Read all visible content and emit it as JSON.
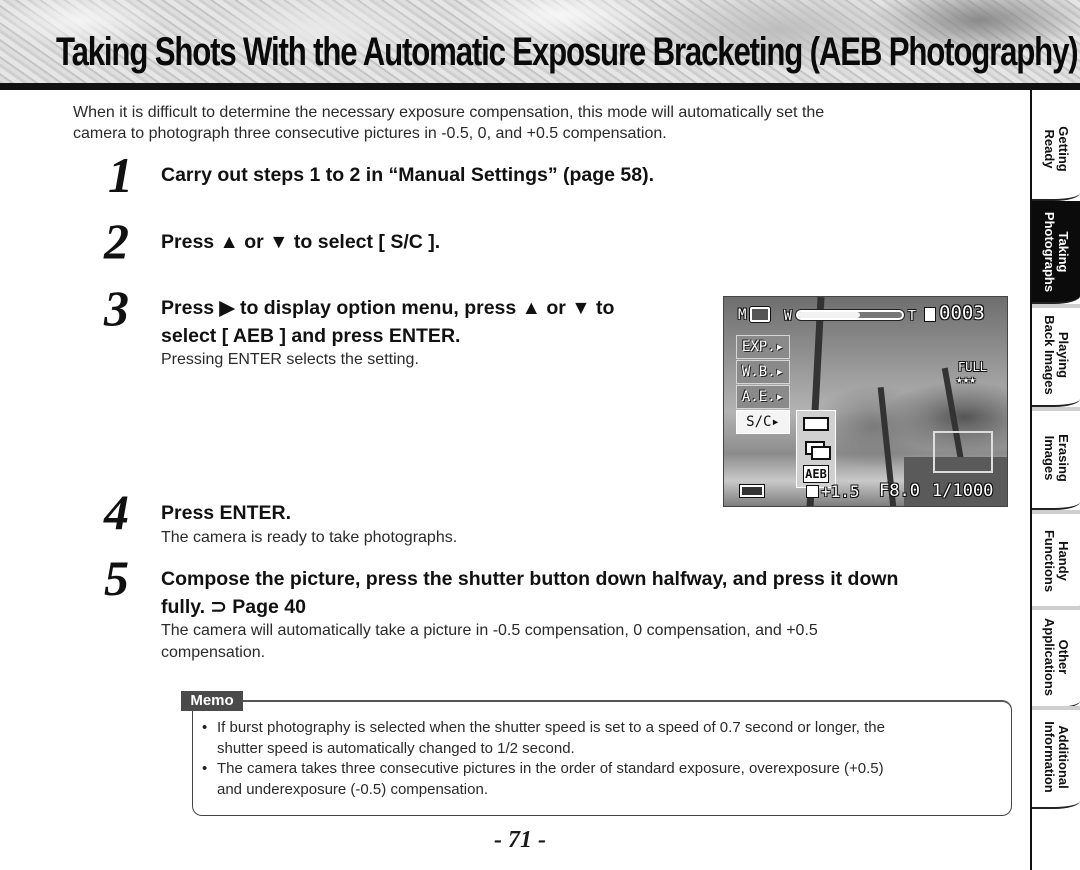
{
  "header": {
    "title": "Taking Shots With the Automatic Exposure Bracketing (AEB Photography)"
  },
  "intro": {
    "line1": "When it is difficult to determine the necessary exposure compensation, this mode will automatically set the",
    "line2": "camera to photograph three consecutive pictures in -0.5, 0, and +0.5 compensation."
  },
  "steps": [
    {
      "number": "1",
      "heading": "Carry out steps 1 to 2 in “Manual Settings” (page 58).",
      "body": ""
    },
    {
      "number": "2",
      "heading": "Press ▲ or ▼ to select [ S/C ].",
      "body": ""
    },
    {
      "number": "3",
      "heading_line1": "Press ▶ to display option menu, press ▲ or ▼ to",
      "heading_line2": "select  [ AEB ] and press ENTER.",
      "body": "Pressing ENTER selects the setting."
    },
    {
      "number": "4",
      "heading": "Press ENTER.",
      "body": "The camera is ready to take photographs."
    },
    {
      "number": "5",
      "heading_line1": "Compose the picture, press the shutter button down halfway, and press it down",
      "heading_line2": "fully. ⊃ Page 40",
      "body_line1": "The camera will automatically take a picture in -0.5 compensation, 0 compensation, and +0.5",
      "body_line2": "compensation."
    }
  ],
  "camera_screen": {
    "mode_icon": "manual-camera-icon",
    "mode_letter": "M",
    "zoom_w": "W",
    "zoom_t": "T",
    "zoom_level": 0.6,
    "frame_counter": "0003",
    "quality": "FULL",
    "quality_stars": "★★★",
    "menu": [
      {
        "label": "EXP.▸",
        "active": false
      },
      {
        "label": "W.B.▸",
        "active": false
      },
      {
        "label": "A.E.▸",
        "active": false
      },
      {
        "label": "S/C▸",
        "active": true
      }
    ],
    "submenu": [
      "single-shot-icon",
      "burst-icon",
      "AEB"
    ],
    "submenu_aeb_label": "AEB",
    "exposure_comp": "+1.5",
    "aperture": "F8.0",
    "shutter": "1/1000"
  },
  "memo": {
    "label": "Memo",
    "items": [
      {
        "line1": "If burst photography is selected when the shutter speed is set to a speed of 0.7 second or longer, the",
        "line2": "shutter speed is automatically changed to 1/2 second."
      },
      {
        "line1": "The camera takes three consecutive pictures in the order of standard exposure, overexposure (+0.5)",
        "line2": "and underexposure (-0.5) compensation."
      }
    ]
  },
  "page_number": "- 71 -",
  "side_tabs": [
    {
      "line1": "Getting",
      "line2": "Ready",
      "active": false
    },
    {
      "line1": "Taking",
      "line2": "Photographs",
      "active": true
    },
    {
      "line1": "Playing",
      "line2": "Back Images",
      "active": false
    },
    {
      "line1": "Erasing",
      "line2": "Images",
      "active": false
    },
    {
      "line1": "Handy",
      "line2": "Functions",
      "active": false
    },
    {
      "line1": "Other",
      "line2": "Applications",
      "active": false
    },
    {
      "line1": "Additional",
      "line2": "Information",
      "active": false
    }
  ]
}
